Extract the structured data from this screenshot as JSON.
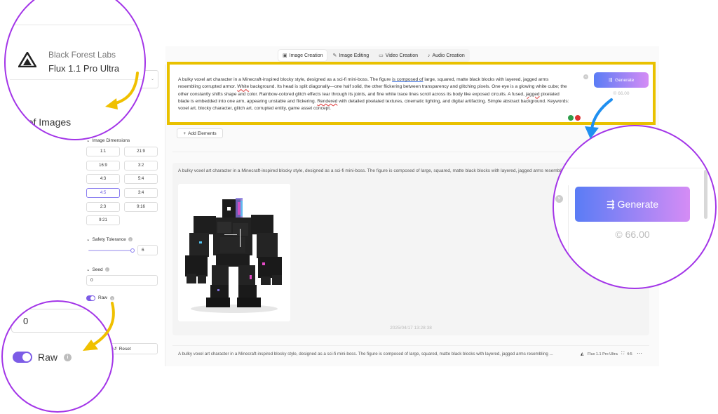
{
  "tabs": [
    {
      "label": "Image Creation",
      "icon": "image-icon",
      "active": true
    },
    {
      "label": "Image Editing",
      "icon": "edit-image-icon",
      "active": false
    },
    {
      "label": "Video Creation",
      "icon": "video-icon",
      "active": false
    },
    {
      "label": "Audio Creation",
      "icon": "audio-icon",
      "active": false
    }
  ],
  "model": {
    "provider": "Black Forest Labs",
    "name": "Flux 1.1 Pro Ultra",
    "partial_provider": "bs",
    "partial_name": "ltra"
  },
  "sidebar": {
    "num_images_label": "Number of Images",
    "num_images_partial": "mages",
    "dimensions_label": "Image Dimensions",
    "ratios": [
      "1:1",
      "21:9",
      "16:9",
      "3:2",
      "4:3",
      "5:4",
      "4:5",
      "3:4",
      "2:3",
      "9:16",
      "9:21"
    ],
    "selected_ratio": "4:5",
    "safety_label": "Safety Tolerance",
    "safety_value": "6",
    "seed_label": "Seed",
    "seed_value": "0",
    "raw_label": "Raw",
    "raw_enabled": true,
    "reset_label": "Reset"
  },
  "prompt": {
    "t1": "A bulky voxel art character in a Minecraft-inspired blocky style, designed as a sci-fi mini-boss. The figure ",
    "t2": "is composed of",
    "t3": " large, squared, matte black blocks with layered, jagged arms",
    "t4": "resembling corrupted armor. ",
    "t5": "White",
    "t6": " background. Its head is split diagonally—one half solid, the other flickering between transparency and glitching pixels. One eye is a glowing white cube; the",
    "t7": "other constantly shifts shape and color. Rainbow-colored glitch effects tear through its joints, and fine white trace lines scroll across its body like exposed circuits. A fused, ",
    "t8": "jagged",
    "t9": " pixelated",
    "t10": "blade is embedded into one arm, appearing unstable and flickering. ",
    "t11": "Rendered",
    "t12": " with detailed pixelated textures, cinematic lighting, and digital artifacting. Simple abstract background. Keywords:",
    "t13": "voxel art, blocky character, glitch art, corrupted entity, game asset concept."
  },
  "generate": {
    "label": "Generate",
    "credits": "66.00"
  },
  "add_elements_label": "Add Elements",
  "result": {
    "prompt_preview": "A bulky voxel art character in a Minecraft-inspired blocky style, designed as a sci-fi mini-boss. The figure is composed of large, squared, matte black blocks with layered, jagged arms resembling",
    "timestamp": "2025/04/17 13:28:38"
  },
  "row2": {
    "prompt_preview": "A bulky voxel art character in a Minecraft-inspired blocky style, designed as a sci-fi mini-boss. The figure is composed of large, squared, matte black blocks with layered, jagged arms resembling ...",
    "model": "Flux 1.1 Pro Ultra",
    "ratio": "4:5"
  },
  "colors": {
    "highlight": "#e9c100",
    "callout": "#a335e8",
    "arrow_yellow": "#f0c000",
    "arrow_blue": "#1f8ff0",
    "accent": "#7c5ce6"
  }
}
